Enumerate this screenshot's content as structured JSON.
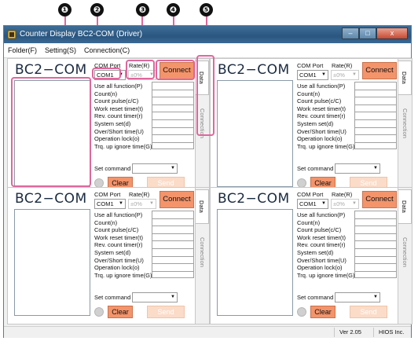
{
  "callouts": [
    "❶",
    "❷",
    "❸",
    "❹",
    "❺"
  ],
  "window": {
    "title": "Counter Display BC2-COM     (Driver)",
    "controls": {
      "minimize": "–",
      "maximize": "□",
      "close": "x"
    }
  },
  "menu": [
    {
      "label": "Folder(F)"
    },
    {
      "label": "Setting(S)"
    },
    {
      "label": "Connection(C)"
    }
  ],
  "panel_template": {
    "logo": "BC2−COM",
    "com_port_label": "COM Port",
    "com_port_value": "COM1",
    "rate_label": "Rate(R)",
    "rate_value": "±0%",
    "connect_label": "Connect",
    "functions": [
      "Use all function(P)",
      "Count(n)",
      "Count pulse(c/C)",
      "Work reset timer(t)",
      "Rev. count timer(r)",
      "System set(d)",
      "Over/Short time(U)",
      "Operation lock(o)",
      "Trq. up ignore time(G)"
    ],
    "set_command_label": "Set command",
    "set_command_value": "",
    "clear_label": "Clear",
    "send_label": "Send",
    "tab_data": "Data",
    "tab_connection": "Connection"
  },
  "status": {
    "version": "Ver 2.05",
    "company": "HIOS Inc."
  },
  "colors": {
    "accent": "#f4946b",
    "callout_border": "#e0679d",
    "titlebar": "#2a5680"
  }
}
